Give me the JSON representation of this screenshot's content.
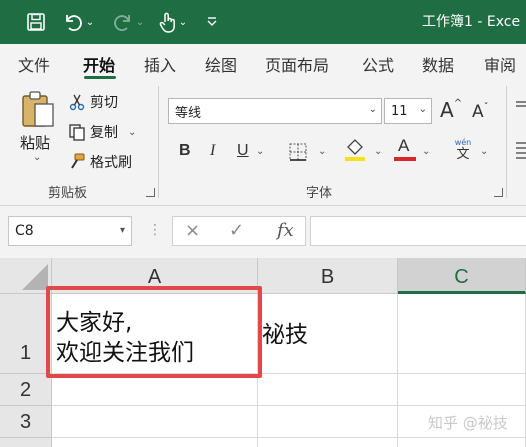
{
  "titlebar": {
    "title": "工作簿1 - Exce",
    "icons": [
      "save-icon",
      "undo-icon",
      "redo-icon",
      "touch-mode-icon",
      "customize-qat-icon"
    ],
    "bg_color": "#1f6e43"
  },
  "tabs": [
    {
      "label": "文件"
    },
    {
      "label": "开始",
      "active": true
    },
    {
      "label": "插入"
    },
    {
      "label": "绘图"
    },
    {
      "label": "页面布局"
    },
    {
      "label": "公式"
    },
    {
      "label": "数据"
    },
    {
      "label": "审阅"
    }
  ],
  "clipboard": {
    "paste_label": "粘贴",
    "cut_label": "剪切",
    "copy_label": "复制",
    "format_painter_label": "格式刷",
    "group_label": "剪贴板"
  },
  "font": {
    "font_name": "等线",
    "font_size": "11",
    "group_label": "字体",
    "bold": "B",
    "italic": "I",
    "underline": "U",
    "font_color_label": "A",
    "phonetic_label": "wén",
    "phonetic_char": "文",
    "highlight_color": "#f7e11a",
    "font_color": "#d9262c"
  },
  "formula_bar": {
    "name_box": "C8",
    "cancel_icon": "×",
    "enter_icon": "✓",
    "fx_label": "fx"
  },
  "grid": {
    "columns": [
      "A",
      "B",
      "C"
    ],
    "selected_column": "C",
    "rows": [
      "1",
      "2",
      "3"
    ],
    "cells": {
      "A1_line1": "大家好,",
      "A1_line2": "欢迎关注我们",
      "B1": "祕技"
    },
    "highlight_color": "#e0484a"
  },
  "watermark": "知乎 @祕技"
}
